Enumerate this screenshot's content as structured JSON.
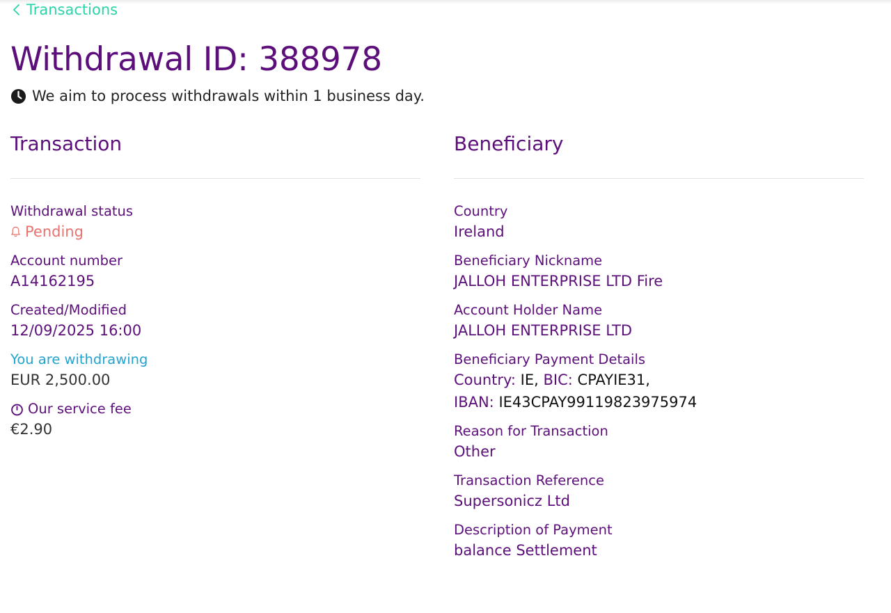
{
  "back_link": {
    "label": "Transactions"
  },
  "title": "Withdrawal ID: 388978",
  "notice": "We aim to process withdrawals within 1 business day.",
  "colors": {
    "brand": "#5c0f7a",
    "back_link": "#2bd4a8",
    "pending": "#e8736f",
    "highlight_label": "#23a3cf"
  },
  "transaction": {
    "heading": "Transaction",
    "status_label": "Withdrawal status",
    "status_value": "Pending",
    "account_label": "Account number",
    "account_value": "A14162195",
    "created_label": "Created/Modified",
    "created_value": "12/09/2025 16:00",
    "withdrawing_label": "You are withdrawing",
    "withdrawing_value": "EUR 2,500.00",
    "fee_label": "Our service fee",
    "fee_value": "€2.90"
  },
  "beneficiary": {
    "heading": "Beneficiary",
    "country_label": "Country",
    "country_value": "Ireland",
    "nickname_label": "Beneficiary Nickname",
    "nickname_value": "JALLOH ENTERPRISE LTD Fire",
    "holder_label": "Account Holder Name",
    "holder_value": "JALLOH ENTERPRISE LTD",
    "payment_label": "Beneficiary Payment Details",
    "payment": {
      "country_key": "Country:",
      "country_val": "IE,",
      "bic_key": "BIC:",
      "bic_val": "CPAYIE31,",
      "iban_key": "IBAN:",
      "iban_val": "IE43CPAY99119823975974"
    },
    "reason_label": "Reason for Transaction",
    "reason_value": "Other",
    "reference_label": "Transaction Reference",
    "reference_value": "Supersonicz Ltd",
    "description_label": "Description of Payment",
    "description_value": "balance Settlement"
  },
  "icons": {
    "back": "chevron-left-icon",
    "notice": "clock-icon",
    "status": "bell-icon",
    "fee": "timer-icon"
  }
}
